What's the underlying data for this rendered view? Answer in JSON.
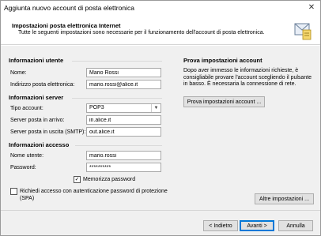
{
  "window": {
    "title": "Aggiunta nuovo account di posta elettronica"
  },
  "header": {
    "title": "Impostazioni posta elettronica Internet",
    "subtitle": "Tutte le seguenti impostazioni sono necessarie per il funzionamento dell'account di posta elettronica."
  },
  "user_info": {
    "heading": "Informazioni utente",
    "name_label": "Nome:",
    "name_value": "Mario Rossi",
    "email_label": "Indirizzo posta elettronica:",
    "email_value": "mario.rossi@alice.it"
  },
  "server_info": {
    "heading": "Informazioni server",
    "account_type_label": "Tipo account:",
    "account_type_value": "POP3",
    "incoming_label": "Server posta in arrivo:",
    "incoming_value": "in.alice.it",
    "outgoing_label": "Server posta in uscita (SMTP):",
    "outgoing_value": "out.alice.it"
  },
  "access_info": {
    "heading": "Informazioni accesso",
    "username_label": "Nome utente:",
    "username_value": "mario.rossi",
    "password_label": "Password:",
    "password_value": "**********",
    "remember_label": "Memorizza password",
    "remember_checked": true,
    "spa_label": "Richiedi accesso con autenticazione password di protezione (SPA)",
    "spa_checked": false
  },
  "test": {
    "heading": "Prova impostazioni account",
    "description": "Dopo aver immesso le informazioni richieste, è consigliabile provare l'account scegliendo il pulsante in basso. È necessaria la connessione di rete.",
    "test_button": "Prova impostazioni account ...",
    "more_settings_button": "Altre impostazioni ..."
  },
  "footer": {
    "back_button": "< Indietro",
    "next_button": "Avanti >",
    "cancel_button": "Annulla"
  }
}
